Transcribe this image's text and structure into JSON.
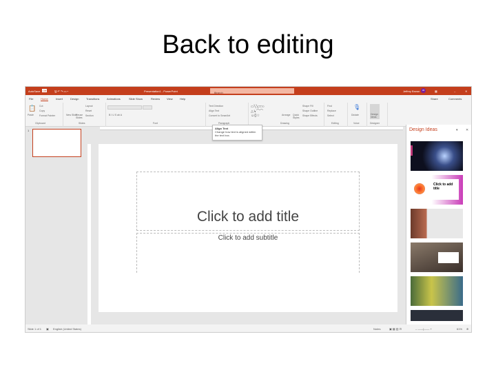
{
  "slide_heading": "Back to editing",
  "app": {
    "titlebar": {
      "autosave": "AutoSave",
      "autosave_state": "Off",
      "doc_title": "Presentation1 - PowerPoint",
      "search_placeholder": "Search",
      "user": "Jeffrey Brown",
      "user_initials": "JB"
    },
    "tabs": [
      "File",
      "Home",
      "Insert",
      "Design",
      "Transitions",
      "Animations",
      "Slide Show",
      "Review",
      "View",
      "Help"
    ],
    "active_tab": "Home",
    "share": "Share",
    "comments": "Comments",
    "ribbon": {
      "groups": [
        "Clipboard",
        "Slides",
        "Font",
        "Paragraph",
        "Drawing",
        "Editing",
        "Voice",
        "Designer"
      ],
      "buttons": [
        "Paste",
        "Cut",
        "Copy",
        "Format Painter",
        "New Slide",
        "Reuse Slides",
        "Layout",
        "Reset",
        "Section",
        "Text Direction",
        "Align Text",
        "Convert to SmartArt",
        "Arrange",
        "Quick Styles",
        "Shape Fill",
        "Shape Outline",
        "Shape Effects",
        "Find",
        "Replace",
        "Select",
        "Dictate",
        "Design Ideas"
      ]
    },
    "tooltip": {
      "title": "Align Text",
      "body": "Change how text is aligned within the text box."
    },
    "slide": {
      "number": "1",
      "title_placeholder": "Click to add title",
      "subtitle_placeholder": "Click to add subtitle"
    },
    "design_pane": {
      "title": "Design Ideas",
      "idea_colors": [
        "#1b1f3a",
        "#ffffff",
        "#e8e8e8",
        "#5a4a3f",
        "#4a6b3a",
        "#2a2f3a"
      ],
      "idea2_text": "Click to add title"
    },
    "status": {
      "slide_count": "Slide 1 of 1",
      "language": "English (United States)",
      "notes": "Notes",
      "zoom": "61%"
    }
  }
}
